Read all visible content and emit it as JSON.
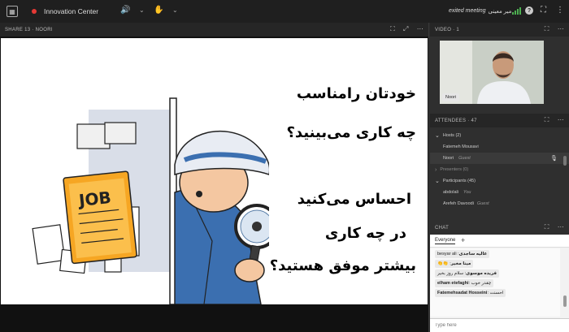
{
  "topbar": {
    "app_name": "Innovation Center",
    "meeting_label": "exited meeting",
    "user_name": "میر معینی"
  },
  "share": {
    "title": "SHARE 13 · NOORI",
    "slide": {
      "line1": "خودتان رامناسب",
      "line2": "چه کاری می‌بینید؟",
      "line3": "احساس می‌کنید",
      "line4": "در چه کاری",
      "line5": "بیشتر موفق هستید؟",
      "job_label": "JOB"
    }
  },
  "video": {
    "title": "VIDEO · 1",
    "name_tag": "Noori"
  },
  "attendees": {
    "title": "ATTENDEES · 47",
    "hosts_label": "Hosts (2)",
    "host1": "Fatemeh Mousavi",
    "host2": "Noori",
    "host2_role": "Guest",
    "presenters_label": "Presenters (0)",
    "participants_label": "Participants (45)",
    "p1": "abdolali",
    "p1_role": "You",
    "p2": "Arefeh Davoodi",
    "p2_role": "Guest"
  },
  "chat": {
    "title": "CHAT",
    "tab_label": "Everyone",
    "messages": [
      {
        "sender": "عالیه ساجدی",
        "text": "besyar ali"
      },
      {
        "sender": "مینا مخیر",
        "text": "👏👏"
      },
      {
        "sender": "فریده موسوی",
        "text": "سلام روز بخیر"
      },
      {
        "sender": "elham etefaghi",
        "text": "چقدر خوب"
      },
      {
        "sender": "Fatemehsadat Hosseini",
        "text": "احسنت"
      }
    ],
    "input_placeholder": "Type here"
  },
  "colors": {
    "record_red": "#e53935",
    "audio_green": "#4caf50",
    "job_orange": "#f6a623",
    "detective_blue": "#3b6fb0"
  }
}
